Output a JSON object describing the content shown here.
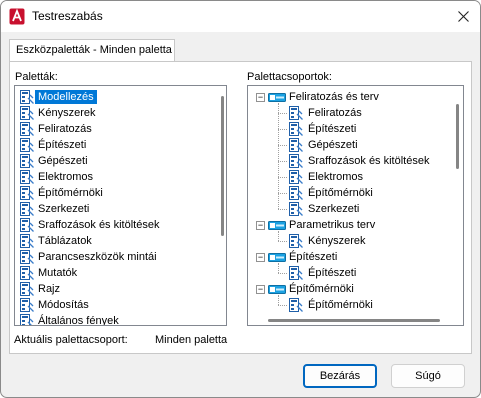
{
  "window": {
    "title": "Testreszabás"
  },
  "tab": {
    "label": "Eszközpaletták - Minden paletta"
  },
  "palettes": {
    "label": "Paletták:",
    "items": [
      "Modellezés",
      "Kényszerek",
      "Feliratozás",
      "Építészeti",
      "Gépészeti",
      "Elektromos",
      "Építőmérnöki",
      "Szerkezeti",
      "Sraffozások és kitöltések",
      "Táblázatok",
      "Parancseszközök mintái",
      "Mutatók",
      "Rajz",
      "Módosítás",
      "Általános fények"
    ],
    "selected_index": 0
  },
  "groups": {
    "label": "Palettacsoportok:",
    "tree": [
      {
        "label": "Feliratozás és terv",
        "expanded": true,
        "children": [
          "Feliratozás",
          "Építészeti",
          "Gépészeti",
          "Sraffozások és kitöltések",
          "Elektromos",
          "Építőmérnöki",
          "Szerkezeti"
        ]
      },
      {
        "label": "Parametrikus terv",
        "expanded": true,
        "children": [
          "Kényszerek"
        ]
      },
      {
        "label": "Építészeti",
        "expanded": true,
        "children": [
          "Építészeti"
        ]
      },
      {
        "label": "Építőmérnöki",
        "expanded": true,
        "children": [
          "Építőmérnöki"
        ]
      }
    ]
  },
  "current": {
    "label": "Aktuális palettacsoport:",
    "value": "Minden paletta"
  },
  "buttons": {
    "close": "Bezárás",
    "help": "Súgó"
  },
  "colors": {
    "selection": "#0078d7",
    "accent": "#0067c0",
    "app_icon": "#c8102e"
  }
}
